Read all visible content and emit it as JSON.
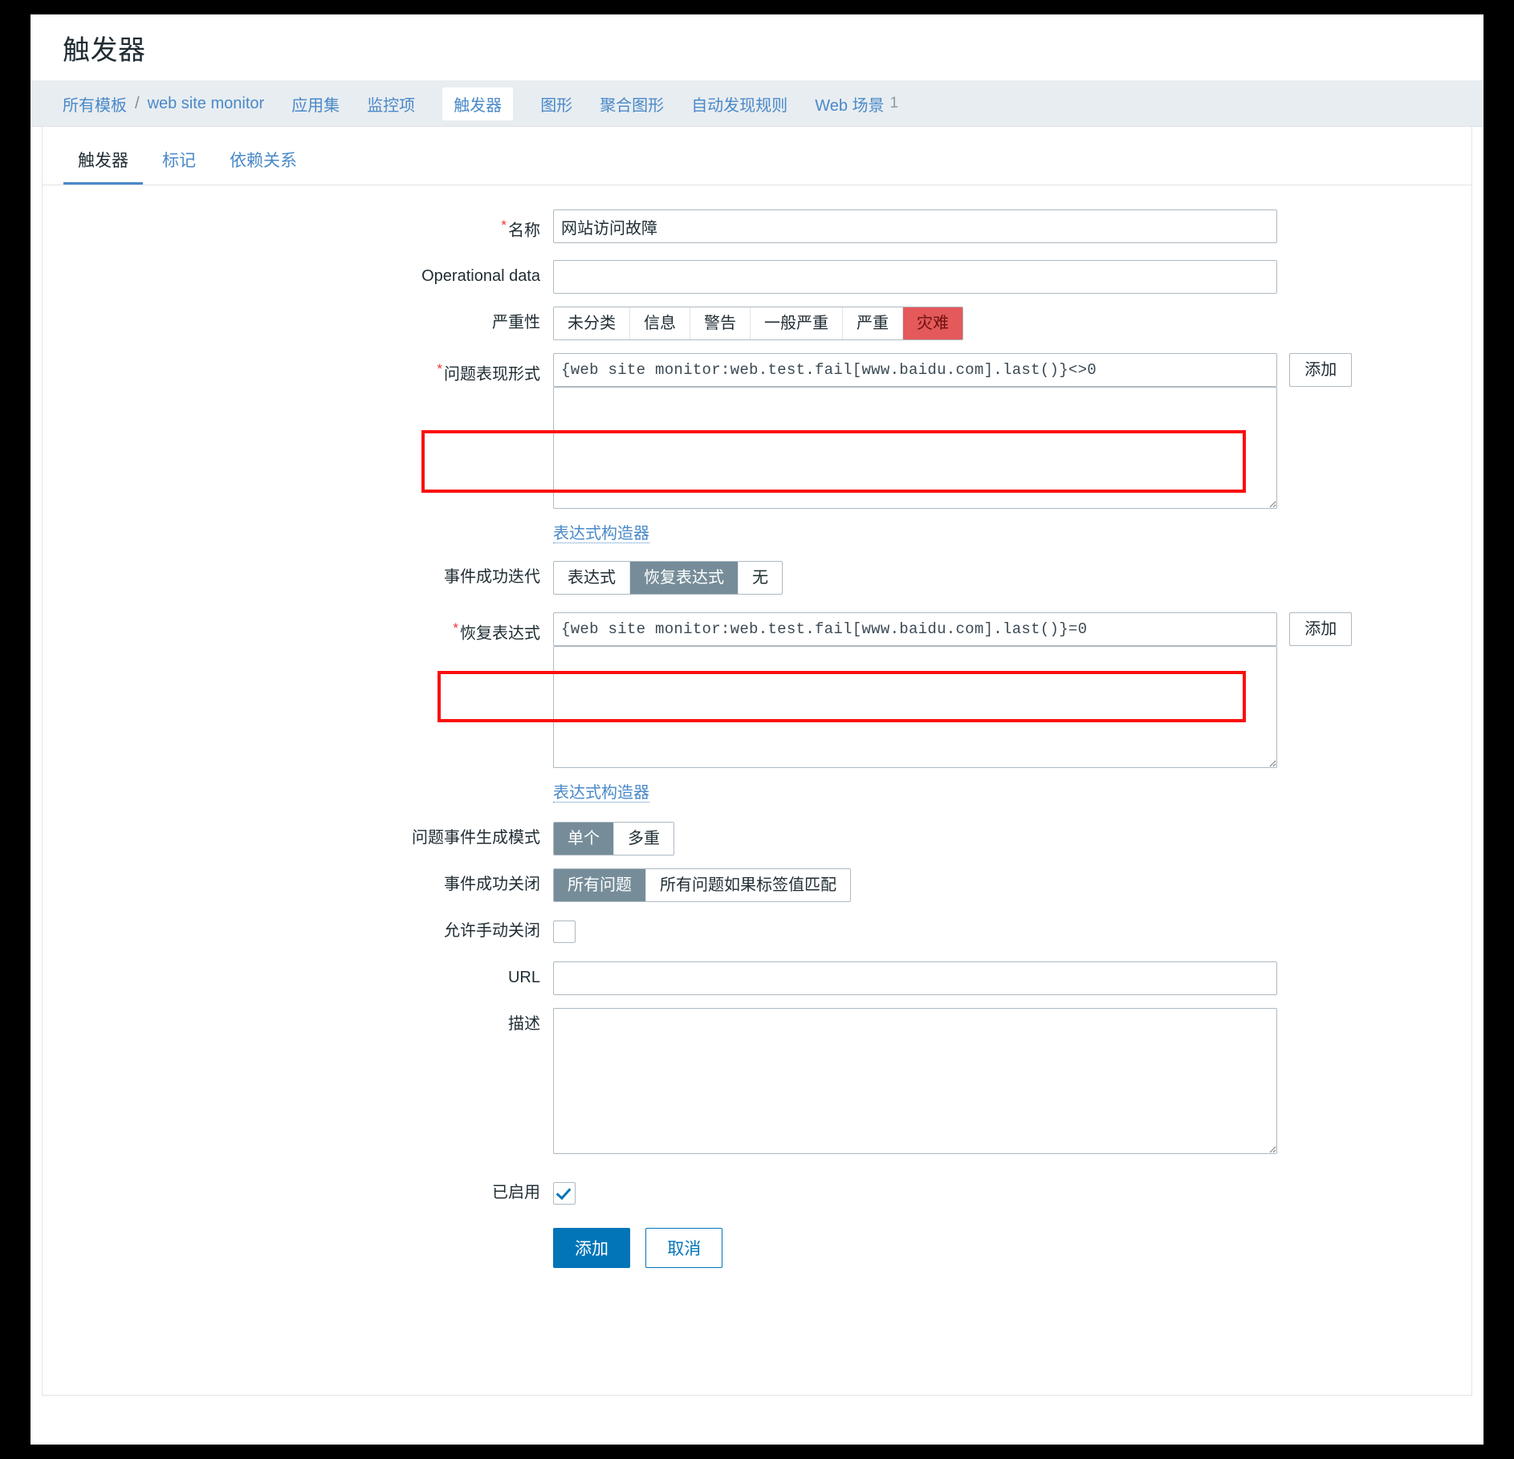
{
  "page": {
    "title": "触发器"
  },
  "objnav": {
    "root": "所有模板",
    "separator": "/",
    "template": "web site monitor",
    "items": [
      {
        "label": "应用集",
        "current": false
      },
      {
        "label": "监控项",
        "current": false
      },
      {
        "label": "触发器",
        "current": true
      },
      {
        "label": "图形",
        "current": false
      },
      {
        "label": "聚合图形",
        "current": false
      },
      {
        "label": "自动发现规则",
        "current": false
      },
      {
        "label": "Web 场景",
        "current": false,
        "count": "1"
      }
    ]
  },
  "tabs": [
    {
      "label": "触发器",
      "active": true
    },
    {
      "label": "标记",
      "active": false
    },
    {
      "label": "依赖关系",
      "active": false
    }
  ],
  "form": {
    "name": {
      "label": "名称",
      "required": true,
      "value": "网站访问故障",
      "placeholder": ""
    },
    "operational_data": {
      "label": "Operational data",
      "required": false,
      "value": "",
      "placeholder": ""
    },
    "severity": {
      "label": "严重性",
      "options": [
        "未分类",
        "信息",
        "警告",
        "一般严重",
        "严重",
        "灾难"
      ],
      "selected": "灾难"
    },
    "problem_expression": {
      "label": "问题表现形式",
      "required": true,
      "value": "{web site monitor:web.test.fail[www.baidu.com].last()}<>0",
      "extra_value": "",
      "add_button": "添加",
      "constructor_link": "表达式构造器"
    },
    "ok_event_generation": {
      "label": "事件成功迭代",
      "options": [
        "表达式",
        "恢复表达式",
        "无"
      ],
      "selected": "恢复表达式"
    },
    "recovery_expression": {
      "label": "恢复表达式",
      "required": true,
      "value": "{web site monitor:web.test.fail[www.baidu.com].last()}=0",
      "extra_value": "",
      "add_button": "添加",
      "constructor_link": "表达式构造器"
    },
    "problem_event_generation_mode": {
      "label": "问题事件生成模式",
      "options": [
        "单个",
        "多重"
      ],
      "selected": "单个"
    },
    "ok_event_closes": {
      "label": "事件成功关闭",
      "options": [
        "所有问题",
        "所有问题如果标签值匹配"
      ],
      "selected": "所有问题"
    },
    "allow_manual_close": {
      "label": "允许手动关闭",
      "checked": false
    },
    "url": {
      "label": "URL",
      "value": "",
      "placeholder": ""
    },
    "description": {
      "label": "描述",
      "value": "",
      "placeholder": ""
    },
    "enabled": {
      "label": "已启用",
      "checked": true
    },
    "actions": {
      "submit": "添加",
      "cancel": "取消"
    }
  },
  "colors": {
    "accent": "#0275b8",
    "link": "#4a89c8",
    "selected_segment": "#768d99",
    "disaster": "#e45959",
    "annotation": "#fb0e0e",
    "nav_background": "#e8edf1"
  }
}
